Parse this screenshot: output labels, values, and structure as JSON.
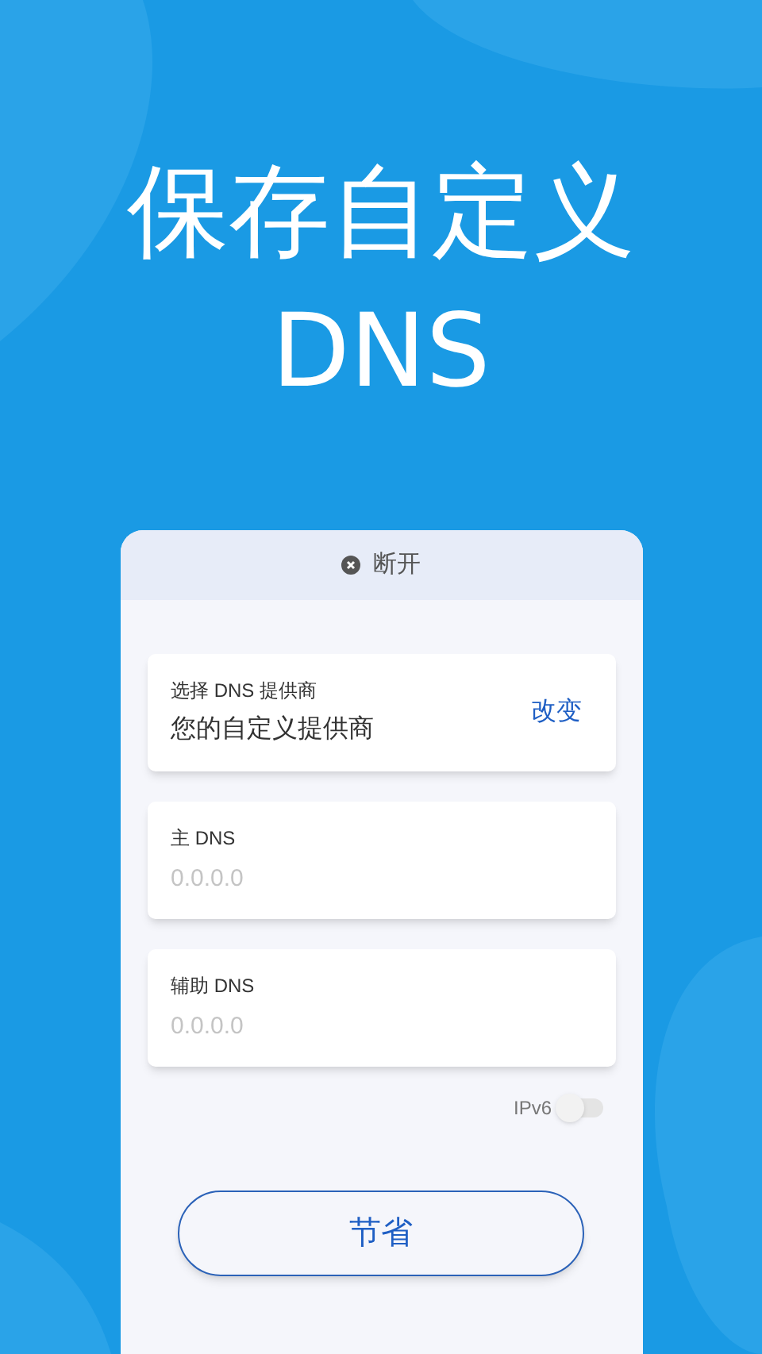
{
  "headline": [
    "保存自定义",
    "DNS"
  ],
  "status": {
    "label": "断开"
  },
  "provider": {
    "label": "选择 DNS 提供商",
    "value": "您的自定义提供商",
    "action": "改变"
  },
  "fields": [
    {
      "label": "主 DNS",
      "placeholder": "0.0.0.0"
    },
    {
      "label": "辅助 DNS",
      "placeholder": "0.0.0.0"
    }
  ],
  "ipv6": {
    "label": "IPv6",
    "on": false
  },
  "save_button": "节省"
}
